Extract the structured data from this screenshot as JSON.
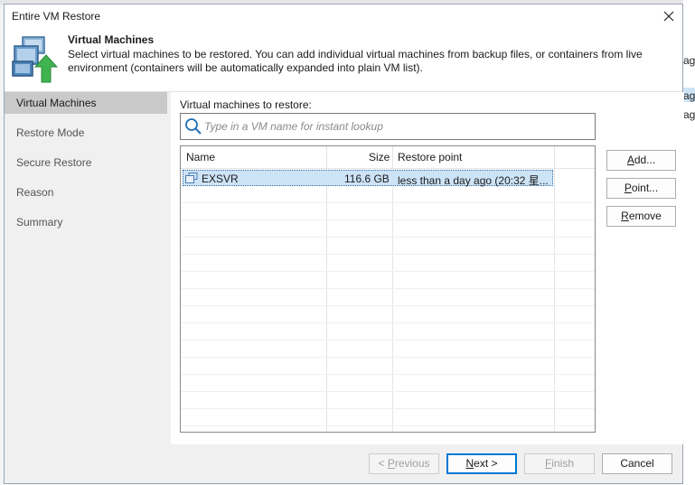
{
  "window": {
    "title": "Entire VM Restore"
  },
  "header": {
    "title": "Virtual Machines",
    "description": "Select virtual machines to be restored. You can add individual virtual machines from backup files, or containers from live environment (containers will be automatically expanded into plain VM list)."
  },
  "sidebar": {
    "items": [
      {
        "label": "Virtual Machines",
        "active": true
      },
      {
        "label": "Restore Mode"
      },
      {
        "label": "Secure Restore"
      },
      {
        "label": "Reason"
      },
      {
        "label": "Summary"
      }
    ]
  },
  "main": {
    "section_label": "Virtual machines to restore:",
    "search_placeholder": "Type in a VM name for instant lookup",
    "columns": [
      "Name",
      "Size",
      "Restore point"
    ],
    "rows": [
      {
        "name": "EXSVR",
        "size": "116.6 GB",
        "restore_point": "less than a day ago (20:32 星..."
      }
    ]
  },
  "side_buttons": {
    "add_pre": "",
    "add_key": "A",
    "add_post": "dd...",
    "point_pre": "",
    "point_key": "P",
    "point_post": "oint...",
    "remove_pre": "",
    "remove_key": "R",
    "remove_post": "emove"
  },
  "footer": {
    "previous_pre": "< ",
    "previous_key": "P",
    "previous_post": "revious",
    "next_pre": "",
    "next_key": "N",
    "next_post": "ext >",
    "finish_pre": "",
    "finish_key": "F",
    "finish_post": "inish",
    "cancel": "Cancel"
  },
  "background": {
    "fragments": [
      "ag",
      "ag",
      "ag"
    ]
  },
  "colors": {
    "accent": "#0078d4",
    "selection": "#cde3f6",
    "icon_arrow": "#3fb34f"
  }
}
